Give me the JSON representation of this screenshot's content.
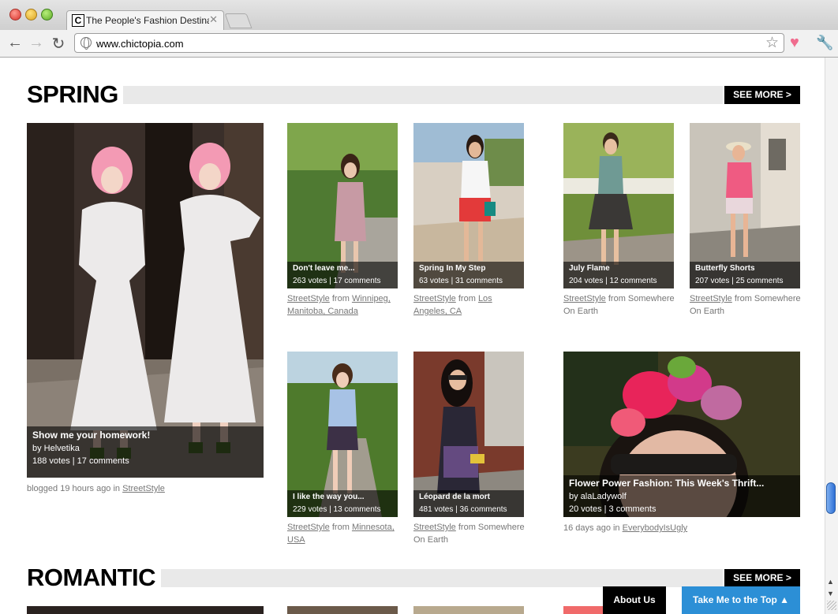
{
  "browser": {
    "tab_title": "The People's Fashion Destina",
    "tab_favicon": "C",
    "url": "www.chictopia.com"
  },
  "sections": [
    {
      "title": "SPRING",
      "see_more": "SEE MORE  >"
    },
    {
      "title": "ROMANTIC",
      "see_more": "SEE MORE  >"
    }
  ],
  "spring": {
    "feature_left": {
      "title": "Show me your homework!",
      "by": "by Helvetika",
      "stats": "188 votes | 17 comments",
      "caption_prefix": "blogged 19 hours ago in",
      "caption_link": "StreetStyle"
    },
    "cards": [
      {
        "title": "Don't leave me...",
        "stats": "263 votes | 17 comments",
        "link": "StreetStyle",
        "from": "from",
        "loc1": "Winnipeg,",
        "loc2": "Manitoba, Canada"
      },
      {
        "title": "Spring In My Step",
        "stats": "63 votes | 31 comments",
        "link": "StreetStyle",
        "from": "from",
        "loc1": "Los",
        "loc2": "Angeles, CA"
      },
      {
        "title": "July Flame",
        "stats": "204 votes | 12 comments",
        "link": "StreetStyle",
        "from": "from Somewhere",
        "loc2": "On Earth"
      },
      {
        "title": "Butterfly Shorts",
        "stats": "207 votes | 25 comments",
        "link": "StreetStyle",
        "from": "from Somewhere",
        "loc2": "On Earth"
      },
      {
        "title": "I like the way you...",
        "stats": "229 votes | 13 comments",
        "link": "StreetStyle",
        "from": "from",
        "loc1": "Minnesota,",
        "loc2": "USA"
      },
      {
        "title": "Léopard de la mort",
        "stats": "481 votes | 36 comments",
        "link": "StreetStyle",
        "from": "from Somewhere",
        "loc2": "On Earth"
      }
    ],
    "feature_right": {
      "title": "Flower Power Fashion: This Week's Thrift...",
      "by": "by alaLadywolf",
      "stats": "20 votes | 3 comments",
      "caption_prefix": "16 days ago in",
      "caption_link": "EverybodyIsUgly"
    }
  },
  "footer_buttons": {
    "about": "About Us",
    "top": "Take Me to the Top  ▲"
  },
  "icons": [
    "back-arrow-icon",
    "forward-arrow-icon",
    "reload-icon",
    "globe-icon",
    "star-icon",
    "heart-icon",
    "wrench-icon",
    "close-icon"
  ],
  "colors": {
    "see_more_bg": "#000000",
    "top_button_bg": "#2c8fd6",
    "heart": "#f06c8e"
  }
}
